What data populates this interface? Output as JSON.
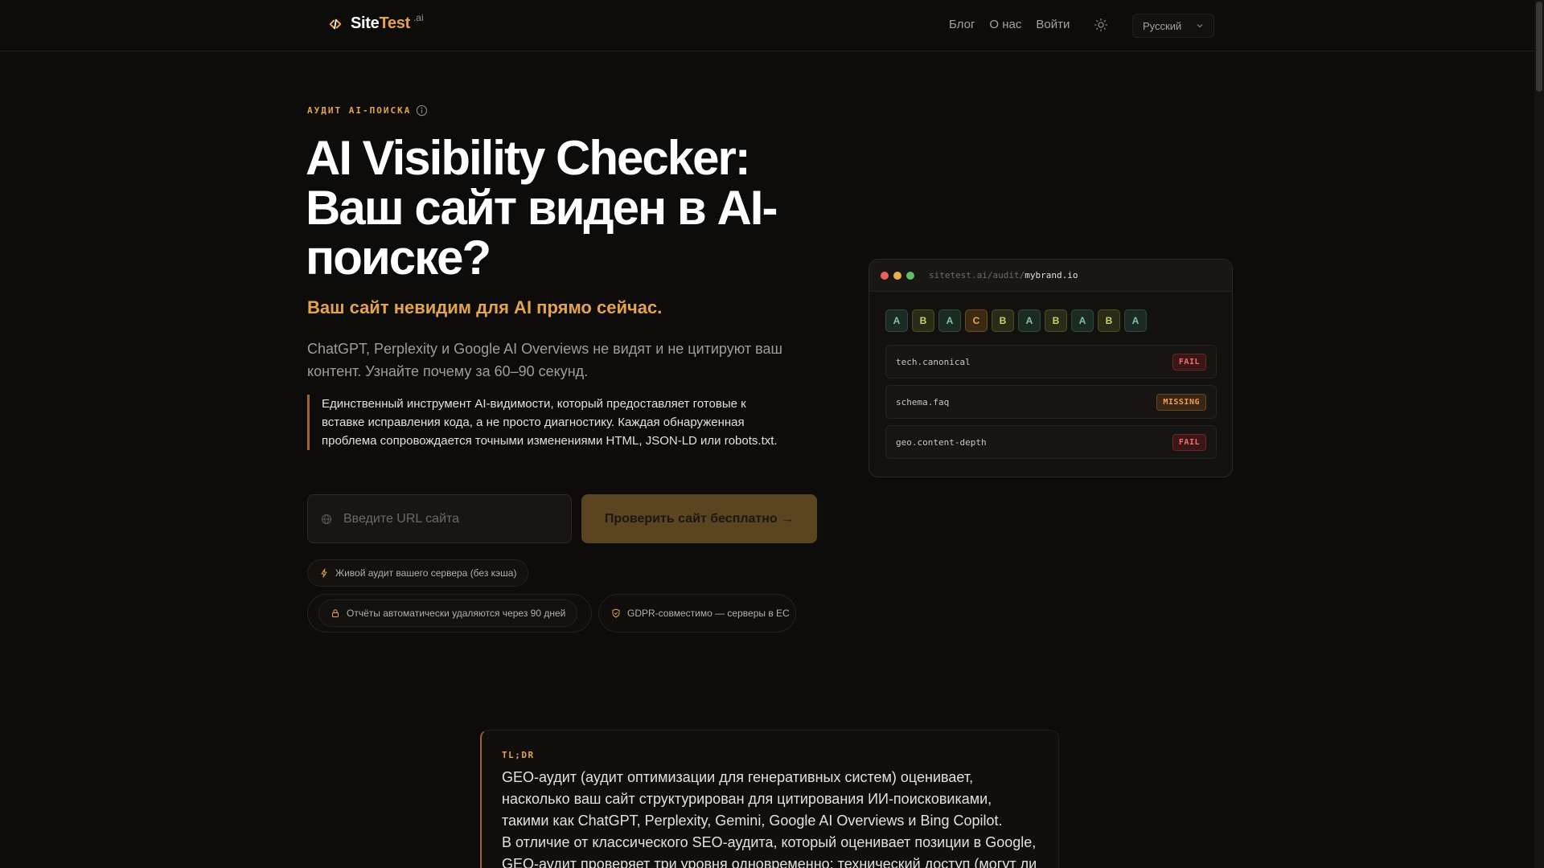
{
  "header": {
    "logo_main": "Site",
    "logo_accent": "Test",
    "logo_sup": ".ai",
    "nav": [
      "Блог",
      "О нас",
      "Войти"
    ],
    "language": "Русский"
  },
  "hero": {
    "eyebrow": "АУДИТ AI-ПОИСКА",
    "title": "AI Visibility Checker: Ваш сайт виден в AI-поиске?",
    "subtitle": "Ваш сайт невидим для AI прямо сейчас.",
    "description": "ChatGPT, Perplexity и Google AI Overviews не видят и не цитируют ваш контент. Узнайте почему за 60–90 секунд.",
    "quote": "Единственный инструмент AI-видимости, который предоставляет готовые к вставке исправления кода, а не просто диагностику. Каждая обнаруженная проблема сопровождается точными изменениями HTML, JSON-LD или robots.txt.",
    "url_placeholder": "Введите URL сайта",
    "cta_label": "Проверить сайт бесплатно →",
    "chips": [
      "Живой аудит вашего сервера (без кэша)",
      "Отчёты автоматически удаляются через 90 дней",
      "GDPR-совместимо — серверы в ЕС"
    ]
  },
  "card": {
    "url_prefix": "sitetest.ai/audit/",
    "url_host": "mybrand.io",
    "grades": [
      "A",
      "B",
      "A",
      "C",
      "B",
      "A",
      "B",
      "A",
      "B",
      "A"
    ],
    "checks": [
      {
        "name": "tech.canonical",
        "status": "FAIL"
      },
      {
        "name": "schema.faq",
        "status": "MISSING"
      },
      {
        "name": "geo.content-depth",
        "status": "FAIL"
      }
    ]
  },
  "tldr": {
    "label": "TL;DR",
    "paragraph1": "GEO-аудит (аудит оптимизации для генеративных систем) оценивает, насколько ваш сайт структурирован для цитирования ИИ-поисковиками, такими как ChatGPT, Perplexity, Gemini, Google AI Overviews и Bing Copilot.",
    "paragraph2": "В отличие от классического SEO-аудита, который оценивает позиции в Google, GEO-аудит проверяет три уровня одновременно: технический доступ (могут ли"
  },
  "colors": {
    "accent": "#e5a44a",
    "background": "#0d0c0b",
    "cta_background": "#5a4520"
  }
}
